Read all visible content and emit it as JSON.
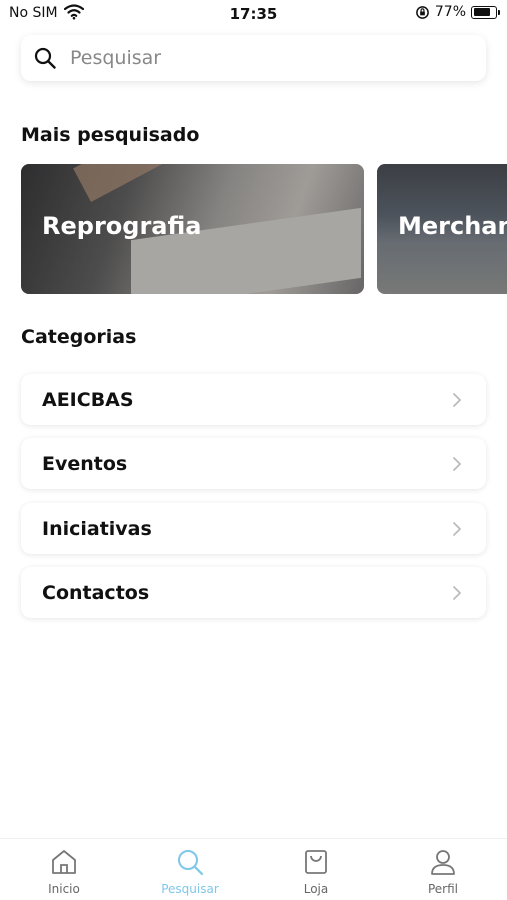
{
  "status_bar": {
    "carrier": "No SIM",
    "time": "17:35",
    "battery": "77%",
    "battery_level": 0.77
  },
  "search": {
    "placeholder": "Pesquisar"
  },
  "most_searched": {
    "title": "Mais pesquisado",
    "cards": [
      {
        "label": "Reprografia"
      },
      {
        "label": "Merchandising"
      }
    ]
  },
  "categories": {
    "title": "Categorias",
    "items": [
      {
        "label": "AEICBAS"
      },
      {
        "label": "Eventos"
      },
      {
        "label": "Iniciativas"
      },
      {
        "label": "Contactos"
      }
    ]
  },
  "tab_bar": {
    "active": "Pesquisar",
    "active_color": "#7fc7ea",
    "tabs": [
      {
        "label": "Inicio",
        "icon": "home-icon"
      },
      {
        "label": "Pesquisar",
        "icon": "search-icon"
      },
      {
        "label": "Loja",
        "icon": "shopping-bag-icon"
      },
      {
        "label": "Perfil",
        "icon": "user-icon"
      }
    ]
  }
}
